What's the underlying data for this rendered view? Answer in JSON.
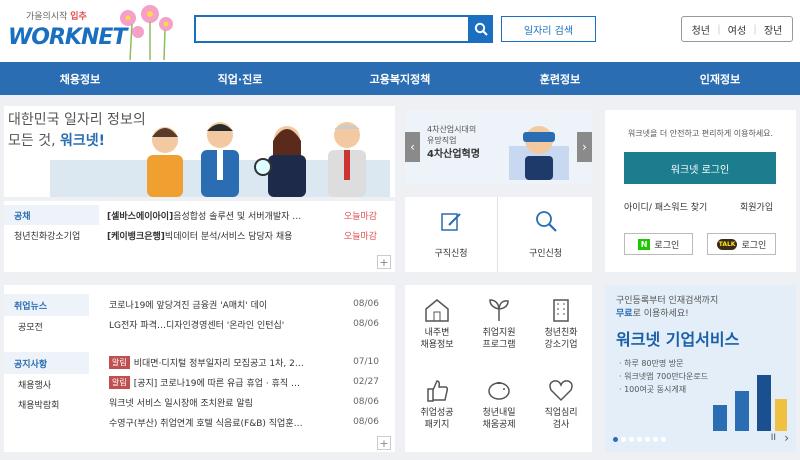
{
  "header": {
    "logo_tagline_pre": "가을의시작 ",
    "logo_tagline_highlight": "입추",
    "logo_text": "WORKNET",
    "search_placeholder": "",
    "job_search_label": "일자리 검색",
    "target_groups": [
      "청년",
      "여성",
      "장년"
    ]
  },
  "gnb": [
    "채용정보",
    "직업·진로",
    "고용복지정책",
    "훈련정보",
    "인재정보"
  ],
  "hero": {
    "line1": "대한민국 일자리 정보의",
    "line2_pre": "모든 것, ",
    "line2_brand": "워크넷!"
  },
  "ticker": [
    {
      "category": "공채",
      "title": "[셀바스에이아이]",
      "detail": " 음성합성 솔루션 및 서버개발자 …",
      "deadline": "오늘마감"
    },
    {
      "category": "청년친화강소기업",
      "title": "[케이뱅크은행]",
      "detail": " 빅데이터 분석/서비스 담당자 채용",
      "deadline": "오늘마감"
    }
  ],
  "carousel": {
    "line1": "4차산업시대의",
    "line2": "유망직업",
    "line3": "4차산업혁명",
    "prev": "‹",
    "next": "›"
  },
  "apply": [
    {
      "label": "구직신청",
      "icon": "pencil-icon"
    },
    {
      "label": "구인신청",
      "icon": "magnifier-icon"
    }
  ],
  "login": {
    "notice": "워크넷을 더 안전하고 편리하게 이용하세요.",
    "login_label": "워크넷 로그인",
    "find_label": "아이디/ 패스워드 찾기",
    "signup_label": "회원가입",
    "naver_label": "로그인",
    "naver_mark": "N",
    "kakao_label": "로그인",
    "kakao_mark": "TALK"
  },
  "news": {
    "tabs1": [
      "취업뉴스",
      "공모전"
    ],
    "items1": [
      {
        "text": "코로나19에 앞당겨진 금융권 'A매치' 데이",
        "date": "08/06"
      },
      {
        "text": "LG전자 파격…디자인경영센터 '온라인 인턴십'",
        "date": "08/06"
      }
    ],
    "tabs2": [
      "공지사항",
      "채용행사",
      "채용박람회"
    ],
    "items2": [
      {
        "badge": "알림",
        "text": "비대면·디지털 정부일자리 모집공고 1차, 2…",
        "date": "07/10"
      },
      {
        "badge": "알림",
        "text": "[공지] 코로나19에 따른 유급 휴업 · 휴직 …",
        "date": "02/27"
      },
      {
        "badge": "",
        "text": "워크넷 서비스 일시장애 조치완료 알림",
        "date": "08/06"
      },
      {
        "badge": "",
        "text": "수영구(부산) 취업연계 호텔 식음료(F&B) 직업훈…",
        "date": "08/06"
      }
    ]
  },
  "services": [
    {
      "label1": "내주변",
      "label2": "채용정보",
      "icon": "house-icon"
    },
    {
      "label1": "취업지원",
      "label2": "프로그램",
      "icon": "sprout-icon"
    },
    {
      "label1": "청년친화",
      "label2": "강소기업",
      "icon": "building-icon"
    },
    {
      "label1": "취업성공",
      "label2": "패키지",
      "icon": "thumbs-up-icon"
    },
    {
      "label1": "청년내일",
      "label2": "채움공제",
      "icon": "piggy-bank-icon"
    },
    {
      "label1": "직업심리",
      "label2": "검사",
      "icon": "heart-icon"
    }
  ],
  "banner": {
    "line1": "구인등록부터 인재검색까지",
    "line2_accent": "무료",
    "line2_rest": "로 이용하세요!",
    "title": "워크넷 기업서비스",
    "bullets": [
      "· 하루 80만명 방문",
      "· 워크넷앱 700만다운로드",
      "· 100여곳 동시게재"
    ],
    "pause": "II",
    "next": "›"
  },
  "colors": {
    "brand_blue": "#2a6db3",
    "login_teal": "#1b7d8d",
    "deadline_red": "#e05050"
  }
}
